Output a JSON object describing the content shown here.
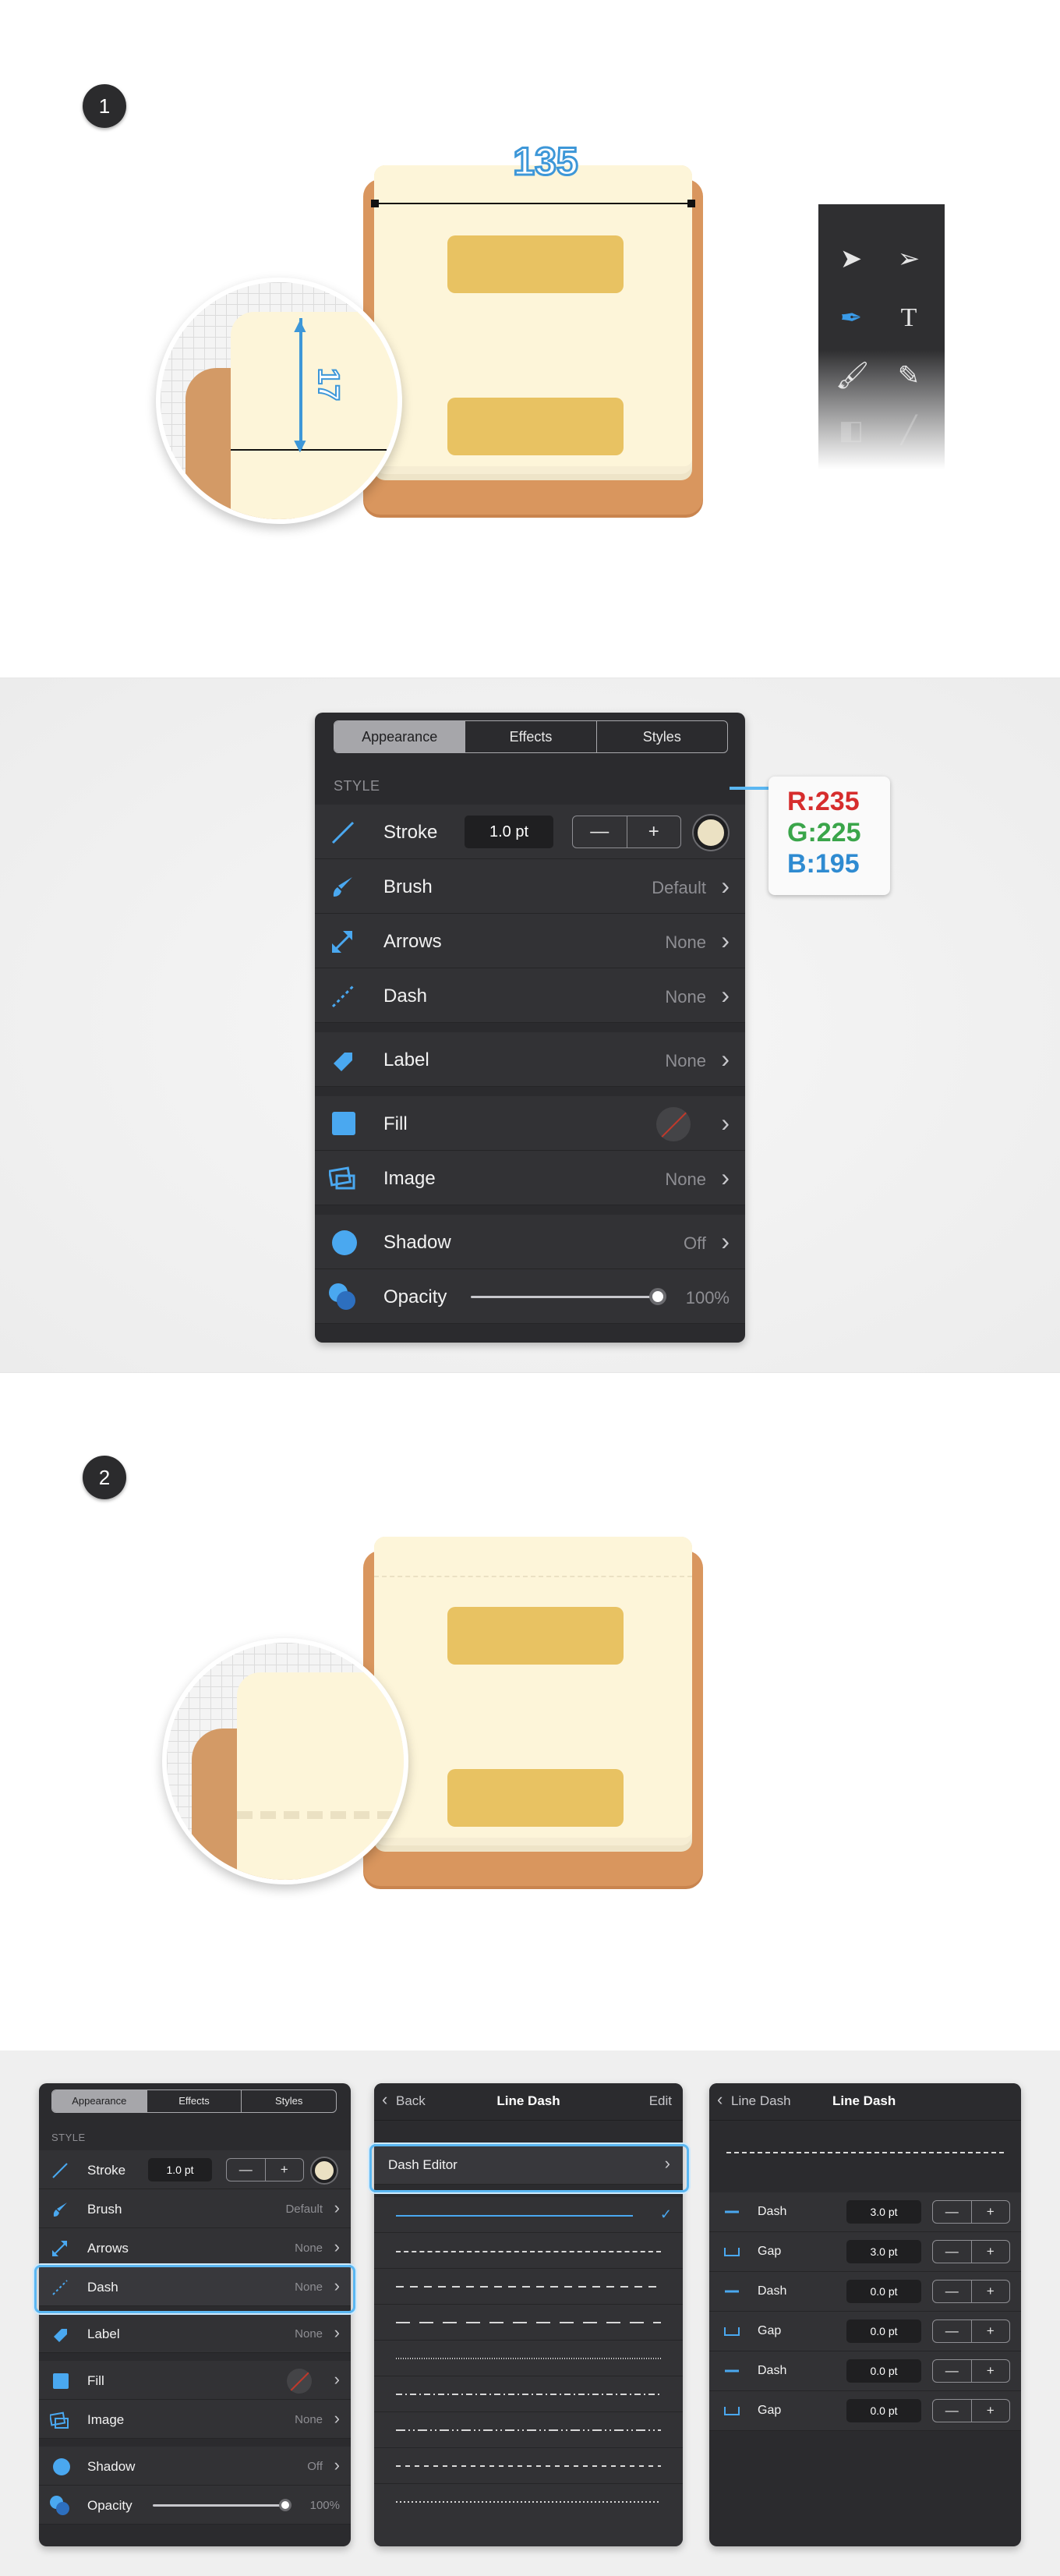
{
  "step1": {
    "badge": "1",
    "width_label": "135",
    "height_label": "17"
  },
  "step2": {
    "badge": "2"
  },
  "panel": {
    "tabs": [
      "Appearance",
      "Effects",
      "Styles"
    ],
    "section_label": "STYLE",
    "rows": {
      "stroke": {
        "label": "Stroke",
        "value": "1.0 pt",
        "minus": "—",
        "plus": "+"
      },
      "brush": {
        "label": "Brush",
        "value": "Default"
      },
      "arrows": {
        "label": "Arrows",
        "value": "None"
      },
      "dash": {
        "label": "Dash",
        "value": "None"
      },
      "label": {
        "label": "Label",
        "value": "None"
      },
      "fill": {
        "label": "Fill"
      },
      "image": {
        "label": "Image",
        "value": "None"
      },
      "shadow": {
        "label": "Shadow",
        "value": "Off"
      },
      "opacity": {
        "label": "Opacity",
        "value": "100%",
        "level": 1.0
      }
    },
    "stroke_color": {
      "r": "R:235",
      "g": "G:225",
      "b": "B:195",
      "hex": "#ebe1c3"
    }
  },
  "line_dash_panel": {
    "back": "Back",
    "title": "Line Dash",
    "edit": "Edit",
    "dash_editor": "Dash Editor"
  },
  "dash_editor_panel": {
    "back": "Line Dash",
    "title": "Line Dash",
    "rows": [
      {
        "label": "Dash",
        "value": "3.0 pt"
      },
      {
        "label": "Gap",
        "value": "3.0 pt"
      },
      {
        "label": "Dash",
        "value": "0.0 pt"
      },
      {
        "label": "Gap",
        "value": "0.0 pt"
      },
      {
        "label": "Dash",
        "value": "0.0 pt"
      },
      {
        "label": "Gap",
        "value": "0.0 pt"
      }
    ],
    "minus": "—",
    "plus": "+"
  },
  "colors": {
    "accent": "#5bb7f2",
    "panel_bg": "#2b2b2e",
    "row_bg": "#323235",
    "icon_blue": "#4aa8f0"
  },
  "chevron": "›",
  "checkmark": "✓"
}
